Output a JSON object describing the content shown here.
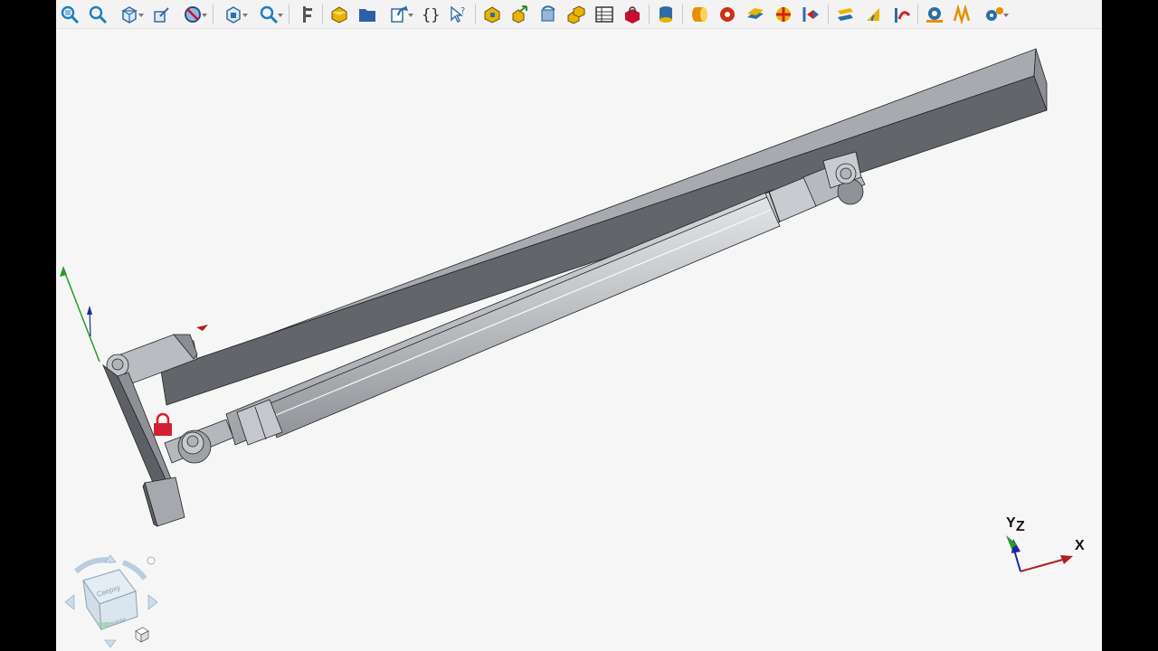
{
  "toolbar": {
    "buttons": [
      {
        "name": "zoom-fit-icon",
        "color": "#1e7fc0"
      },
      {
        "name": "zoom-window-icon",
        "color": "#1e7fc0"
      },
      {
        "name": "view-orientation-icon",
        "color": "#2e6ca8",
        "dropdown": true
      },
      {
        "name": "normal-to-icon",
        "color": "#2e6ca8"
      },
      {
        "name": "display-mode-icon",
        "color": "#1d4f8a",
        "dropdown": true
      },
      {
        "name": "section-view-icon",
        "color": "#2e6ca8",
        "dropdown": true
      },
      {
        "name": "zoom-options-icon",
        "color": "#1e7fc0",
        "dropdown": true
      },
      {
        "name": "measure-caliper-icon",
        "color": "#555555"
      },
      {
        "name": "part-icon",
        "color": "#e8b400"
      },
      {
        "name": "folder-icon",
        "color": "#2d5fa8"
      },
      {
        "name": "export-icon",
        "color": "#2e6ca8",
        "dropdown": true
      },
      {
        "name": "variables-braces-icon",
        "color": "#333333"
      },
      {
        "name": "help-pointer-icon",
        "color": "#2e6ca8"
      },
      {
        "name": "component-icon",
        "color": "#e8b400"
      },
      {
        "name": "move-component-icon",
        "color": "#3a8a2a"
      },
      {
        "name": "rotate-component-icon",
        "color": "#2e6ca8"
      },
      {
        "name": "assembly-icon",
        "color": "#e8b400"
      },
      {
        "name": "table-icon",
        "color": "#333333"
      },
      {
        "name": "constraint-lock-icon",
        "color": "#c8102e"
      },
      {
        "name": "database-icon",
        "color": "#e8b400"
      },
      {
        "name": "mate-cylinder-icon",
        "color": "#e89000"
      },
      {
        "name": "mate-fixed-icon",
        "color": "#d03010"
      },
      {
        "name": "mate-plane-icon",
        "color": "#2e6ca8"
      },
      {
        "name": "mate-point-icon",
        "color": "#d02020"
      },
      {
        "name": "mate-distance-icon",
        "color": "#d02020"
      },
      {
        "name": "mate-parallel-icon",
        "color": "#e8b400"
      },
      {
        "name": "mate-angle-icon",
        "color": "#e8b400"
      },
      {
        "name": "mate-rotation-icon",
        "color": "#d02020"
      },
      {
        "name": "gear-mate-icon",
        "color": "#2e6ca8"
      },
      {
        "name": "spring-icon",
        "color": "#e89000"
      },
      {
        "name": "settings-gears-icon",
        "color": "#2e6ca8",
        "dropdown": true
      }
    ]
  },
  "view_cube": {
    "face_top_label": "Сверху",
    "face_front_label": "Спереди"
  },
  "triad": {
    "x_label": "X",
    "y_label": "Y",
    "z_label": "Z"
  },
  "colors": {
    "background": "#f6f6f6",
    "part_light": "#a9adb2",
    "part_mid": "#8c9095",
    "part_dark": "#5f6368",
    "lock_red": "#d32030",
    "axis_x": "#b02020",
    "axis_y": "#2a9a2a",
    "axis_z": "#1a2a9a"
  }
}
